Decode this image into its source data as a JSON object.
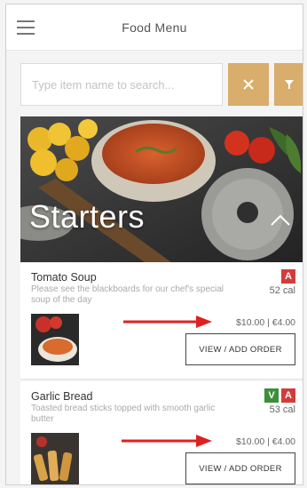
{
  "header": {
    "title": "Food Menu",
    "menu_icon": "hamburger-icon"
  },
  "search": {
    "placeholder": "Type item name to search...",
    "clear_icon": "close-icon",
    "filter_icon": "filter-icon"
  },
  "hero": {
    "title": "Starters",
    "toggle_icon": "chevron-up-icon"
  },
  "items": [
    {
      "name": "Tomato Soup",
      "description": "Please see the blackboards for our chef's special soup of the day",
      "badges": [
        "A"
      ],
      "calories": "52 cal",
      "price": "$10.00 | €4.00",
      "button_label": "VIEW / ADD ORDER"
    },
    {
      "name": "Garlic Bread",
      "description": "Toasted bread sticks topped with smooth garlic butter",
      "badges": [
        "V",
        "A"
      ],
      "calories": "53 cal",
      "price": "$10.00 | €4.00",
      "button_label": "VIEW / ADD ORDER"
    }
  ],
  "colors": {
    "accent_gold": "#d9ad6c",
    "allergen_red": "#d43c3c",
    "vegetarian_green": "#3e8e3a",
    "annotation_arrow": "#e02020"
  }
}
